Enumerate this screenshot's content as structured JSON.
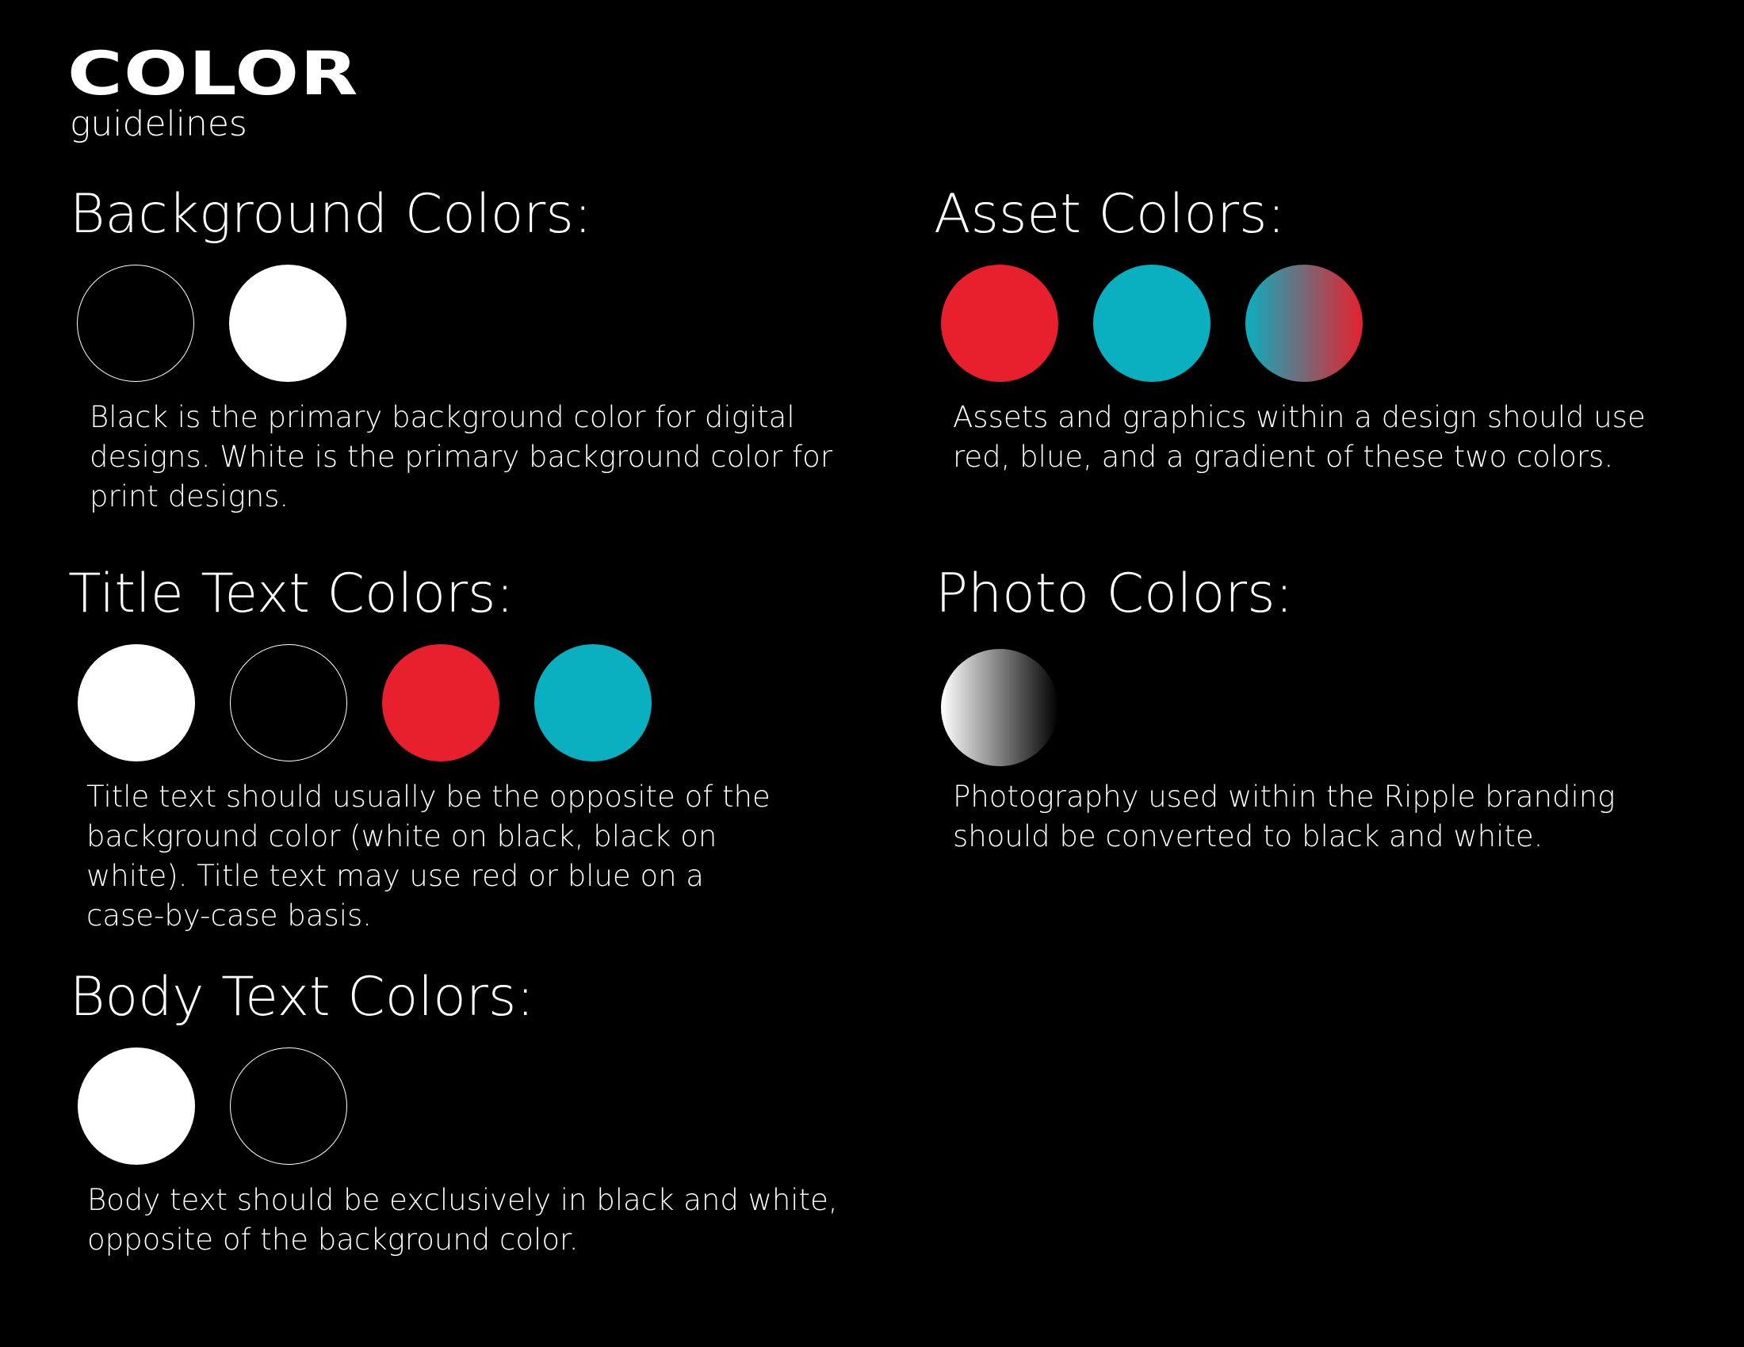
{
  "header": {
    "title": "COLOR",
    "subtitle": "guidelines"
  },
  "colors": {
    "black": "#000000",
    "white": "#ffffff",
    "red": "#e8202d",
    "blue": "#0aafc0",
    "gradient": "linear-gradient(to right, #0aafc0, #e8202d)",
    "grayscale": "linear-gradient(to right, #ffffff, #000000)"
  },
  "sections": {
    "background": {
      "heading": "Background Colors:",
      "swatches": [
        "black",
        "white"
      ],
      "description": "Black is the primary background color for digital designs. White is the primary background color for print designs."
    },
    "asset": {
      "heading": "Asset Colors:",
      "swatches": [
        "red",
        "blue",
        "red-blue gradient"
      ],
      "description": "Assets and graphics within a design should use red, blue, and a gradient of these two colors."
    },
    "title_text": {
      "heading": "Title Text Colors:",
      "swatches": [
        "white",
        "black",
        "red",
        "blue"
      ],
      "description": "Title text should usually be the opposite of the background color (white on black, black on white). Title text may use red or blue on a case-by-case basis."
    },
    "photo": {
      "heading": "Photo Colors:",
      "swatches": [
        "white-black gradient"
      ],
      "description": "Photography used within the Ripple branding should be converted to black and white."
    },
    "body_text": {
      "heading": "Body Text Colors:",
      "swatches": [
        "white",
        "black"
      ],
      "description": "Body text should be exclusively in black and white, opposite of the background color."
    }
  }
}
